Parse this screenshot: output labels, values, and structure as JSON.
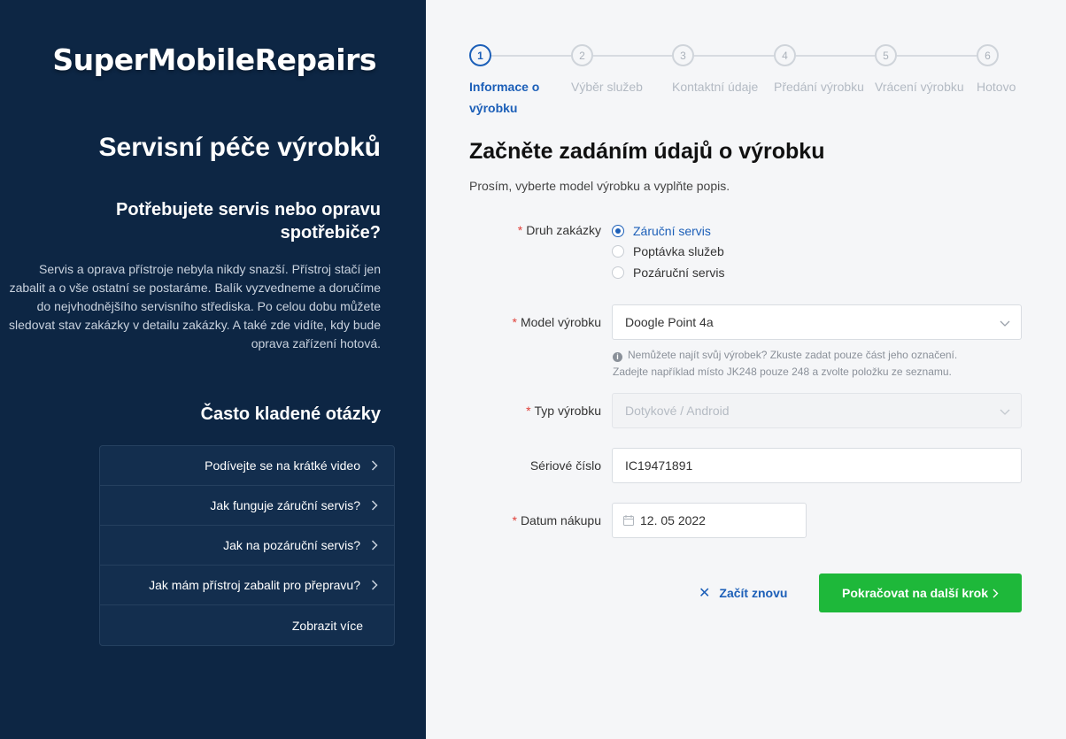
{
  "brand": "SuperMobileRepairs",
  "left": {
    "hero_title": "Servisní péče výrobků",
    "sub_title": "Potřebujete servis nebo opravu spotřebiče?",
    "description": "Servis a oprava přístroje nebyla nikdy snazší. Přístroj stačí jen zabalit a o vše ostatní se postaráme. Balík vyzvedneme a doručíme do nejvhodnějšího servisního střediska. Po celou dobu můžete sledovat stav zakázky v detailu zakázky. A také zde vidíte, kdy bude oprava zařízení hotová.",
    "faq_title": "Často kladené otázky",
    "faq_items": [
      {
        "label": "Podívejte se na krátké video",
        "icon": "chevron-right-icon"
      },
      {
        "label": "Jak funguje záruční servis?",
        "icon": "chevron-right-icon"
      },
      {
        "label": "Jak na pozáruční servis?",
        "icon": "chevron-right-icon"
      },
      {
        "label": "Jak mám přístroj zabalit pro přepravu?",
        "icon": "chevron-right-icon"
      }
    ],
    "faq_more": "Zobrazit více"
  },
  "steps": [
    {
      "number": "1",
      "label": "Informace o výrobku",
      "active": true
    },
    {
      "number": "2",
      "label": "Výběr služeb",
      "active": false
    },
    {
      "number": "3",
      "label": "Kontaktní údaje",
      "active": false
    },
    {
      "number": "4",
      "label": "Předání výrobku",
      "active": false
    },
    {
      "number": "5",
      "label": "Vrácení výrobku",
      "active": false
    },
    {
      "number": "6",
      "label": "Hotovo",
      "active": false
    }
  ],
  "form": {
    "title": "Začněte zadáním údajů o výrobku",
    "subtitle": "Prosím, vyberte model výrobku a vyplňte popis.",
    "order_type": {
      "label": "Druh zakázky",
      "options": [
        "Záruční servis",
        "Poptávka služeb",
        "Pozáruční servis"
      ],
      "selected": "Záruční servis"
    },
    "model": {
      "label": "Model výrobku",
      "value": "Doogle Point 4a"
    },
    "model_hint_1": "Nemůžete najít svůj výrobek? Zkuste zadat pouze část jeho označení.",
    "model_hint_2": "Zadejte například místo JK248 pouze 248 a zvolte položku ze seznamu.",
    "product_type": {
      "label": "Typ výrobku",
      "value": "Dotykové / Android"
    },
    "serial": {
      "label": "Sériové číslo",
      "value": "IC19471891"
    },
    "purchase_date": {
      "label": "Datum nákupu",
      "value": "12. 05 2022"
    },
    "reset_label": "Začít znovu",
    "next_label": "Pokračovat na další krok"
  },
  "colors": {
    "sidebar_bg": "#0d2644",
    "accent": "#1c5fb8",
    "primary_button": "#1eb83a",
    "required": "#e0403a"
  }
}
